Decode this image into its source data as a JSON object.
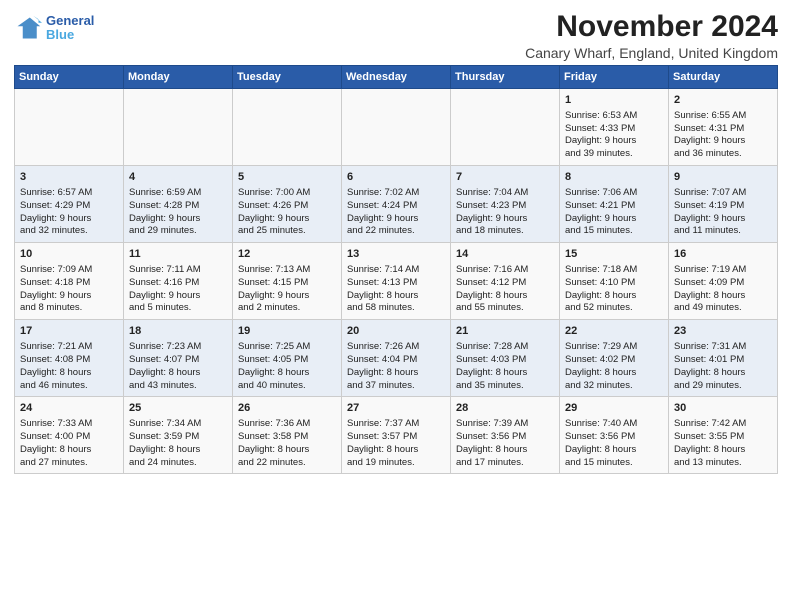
{
  "header": {
    "logo_text_line1": "General",
    "logo_text_line2": "Blue",
    "month_title": "November 2024",
    "location": "Canary Wharf, England, United Kingdom"
  },
  "weekdays": [
    "Sunday",
    "Monday",
    "Tuesday",
    "Wednesday",
    "Thursday",
    "Friday",
    "Saturday"
  ],
  "weeks": [
    [
      {
        "day": "",
        "info": ""
      },
      {
        "day": "",
        "info": ""
      },
      {
        "day": "",
        "info": ""
      },
      {
        "day": "",
        "info": ""
      },
      {
        "day": "",
        "info": ""
      },
      {
        "day": "1",
        "info": "Sunrise: 6:53 AM\nSunset: 4:33 PM\nDaylight: 9 hours\nand 39 minutes."
      },
      {
        "day": "2",
        "info": "Sunrise: 6:55 AM\nSunset: 4:31 PM\nDaylight: 9 hours\nand 36 minutes."
      }
    ],
    [
      {
        "day": "3",
        "info": "Sunrise: 6:57 AM\nSunset: 4:29 PM\nDaylight: 9 hours\nand 32 minutes."
      },
      {
        "day": "4",
        "info": "Sunrise: 6:59 AM\nSunset: 4:28 PM\nDaylight: 9 hours\nand 29 minutes."
      },
      {
        "day": "5",
        "info": "Sunrise: 7:00 AM\nSunset: 4:26 PM\nDaylight: 9 hours\nand 25 minutes."
      },
      {
        "day": "6",
        "info": "Sunrise: 7:02 AM\nSunset: 4:24 PM\nDaylight: 9 hours\nand 22 minutes."
      },
      {
        "day": "7",
        "info": "Sunrise: 7:04 AM\nSunset: 4:23 PM\nDaylight: 9 hours\nand 18 minutes."
      },
      {
        "day": "8",
        "info": "Sunrise: 7:06 AM\nSunset: 4:21 PM\nDaylight: 9 hours\nand 15 minutes."
      },
      {
        "day": "9",
        "info": "Sunrise: 7:07 AM\nSunset: 4:19 PM\nDaylight: 9 hours\nand 11 minutes."
      }
    ],
    [
      {
        "day": "10",
        "info": "Sunrise: 7:09 AM\nSunset: 4:18 PM\nDaylight: 9 hours\nand 8 minutes."
      },
      {
        "day": "11",
        "info": "Sunrise: 7:11 AM\nSunset: 4:16 PM\nDaylight: 9 hours\nand 5 minutes."
      },
      {
        "day": "12",
        "info": "Sunrise: 7:13 AM\nSunset: 4:15 PM\nDaylight: 9 hours\nand 2 minutes."
      },
      {
        "day": "13",
        "info": "Sunrise: 7:14 AM\nSunset: 4:13 PM\nDaylight: 8 hours\nand 58 minutes."
      },
      {
        "day": "14",
        "info": "Sunrise: 7:16 AM\nSunset: 4:12 PM\nDaylight: 8 hours\nand 55 minutes."
      },
      {
        "day": "15",
        "info": "Sunrise: 7:18 AM\nSunset: 4:10 PM\nDaylight: 8 hours\nand 52 minutes."
      },
      {
        "day": "16",
        "info": "Sunrise: 7:19 AM\nSunset: 4:09 PM\nDaylight: 8 hours\nand 49 minutes."
      }
    ],
    [
      {
        "day": "17",
        "info": "Sunrise: 7:21 AM\nSunset: 4:08 PM\nDaylight: 8 hours\nand 46 minutes."
      },
      {
        "day": "18",
        "info": "Sunrise: 7:23 AM\nSunset: 4:07 PM\nDaylight: 8 hours\nand 43 minutes."
      },
      {
        "day": "19",
        "info": "Sunrise: 7:25 AM\nSunset: 4:05 PM\nDaylight: 8 hours\nand 40 minutes."
      },
      {
        "day": "20",
        "info": "Sunrise: 7:26 AM\nSunset: 4:04 PM\nDaylight: 8 hours\nand 37 minutes."
      },
      {
        "day": "21",
        "info": "Sunrise: 7:28 AM\nSunset: 4:03 PM\nDaylight: 8 hours\nand 35 minutes."
      },
      {
        "day": "22",
        "info": "Sunrise: 7:29 AM\nSunset: 4:02 PM\nDaylight: 8 hours\nand 32 minutes."
      },
      {
        "day": "23",
        "info": "Sunrise: 7:31 AM\nSunset: 4:01 PM\nDaylight: 8 hours\nand 29 minutes."
      }
    ],
    [
      {
        "day": "24",
        "info": "Sunrise: 7:33 AM\nSunset: 4:00 PM\nDaylight: 8 hours\nand 27 minutes."
      },
      {
        "day": "25",
        "info": "Sunrise: 7:34 AM\nSunset: 3:59 PM\nDaylight: 8 hours\nand 24 minutes."
      },
      {
        "day": "26",
        "info": "Sunrise: 7:36 AM\nSunset: 3:58 PM\nDaylight: 8 hours\nand 22 minutes."
      },
      {
        "day": "27",
        "info": "Sunrise: 7:37 AM\nSunset: 3:57 PM\nDaylight: 8 hours\nand 19 minutes."
      },
      {
        "day": "28",
        "info": "Sunrise: 7:39 AM\nSunset: 3:56 PM\nDaylight: 8 hours\nand 17 minutes."
      },
      {
        "day": "29",
        "info": "Sunrise: 7:40 AM\nSunset: 3:56 PM\nDaylight: 8 hours\nand 15 minutes."
      },
      {
        "day": "30",
        "info": "Sunrise: 7:42 AM\nSunset: 3:55 PM\nDaylight: 8 hours\nand 13 minutes."
      }
    ]
  ]
}
